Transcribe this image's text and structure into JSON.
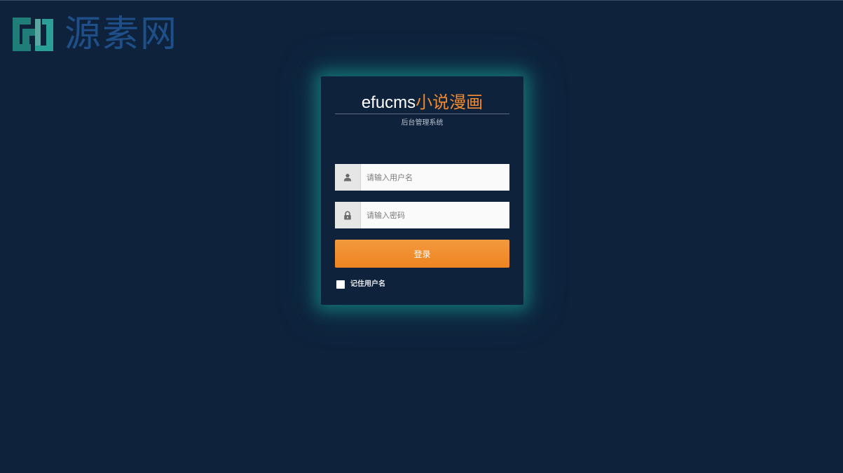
{
  "watermark": {
    "text": "源素网",
    "icon": "gj-logo-icon",
    "color": "#1f4f88"
  },
  "login": {
    "title_en": "efucms",
    "title_cn": "小说漫画",
    "subtitle": "后台管理系统",
    "username": {
      "icon": "user-icon",
      "value": "",
      "placeholder": "请输入用户名"
    },
    "password": {
      "icon": "lock-icon",
      "value": "",
      "placeholder": "请输入密码"
    },
    "submit_label": "登录",
    "remember_label": "记住用户名",
    "remember_checked": false
  },
  "colors": {
    "background": "#0e223c",
    "accent": "#f08a2e",
    "glow": "#18a096"
  }
}
